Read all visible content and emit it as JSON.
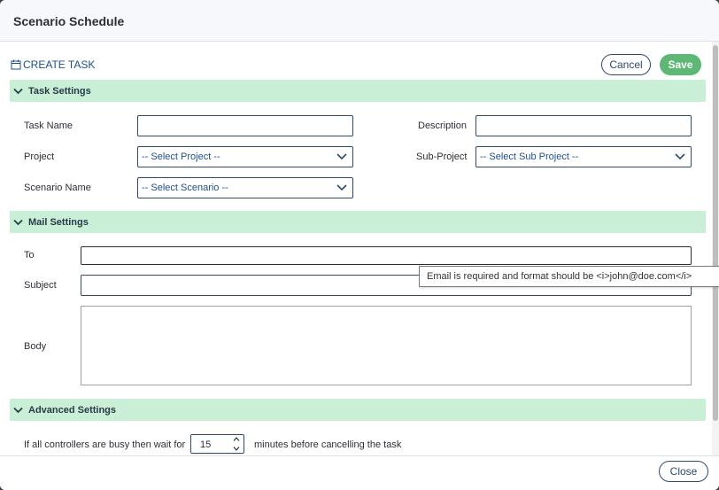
{
  "dialog": {
    "title": "Scenario Schedule"
  },
  "toolbar": {
    "create_task": "CREATE TASK",
    "cancel_label": "Cancel",
    "save_label": "Save"
  },
  "task_settings": {
    "header": "Task Settings",
    "task_name_label": "Task Name",
    "task_name_value": "",
    "description_label": "Description",
    "description_value": "",
    "project_label": "Project",
    "project_selected": "-- Select Project --",
    "sub_project_label": "Sub-Project",
    "sub_project_selected": "-- Select Sub Project --",
    "scenario_label": "Scenario Name",
    "scenario_selected": "-- Select Scenario --"
  },
  "mail_settings": {
    "header": "Mail Settings",
    "to_label": "To",
    "subject_label": "Subject",
    "body_label": "Body",
    "email_tooltip": "Email is required and format should be <i>john@doe.com</i>"
  },
  "advanced_settings": {
    "header": "Advanced Settings",
    "wait_prefix": "If all controllers are busy then wait for",
    "wait_minutes": "15",
    "wait_suffix": "minutes before cancelling the task"
  },
  "footer": {
    "close_label": "Close"
  },
  "icons": {
    "calendar": "calendar-icon",
    "chevron": "chevron-down-icon"
  },
  "colors": {
    "accent": "#1f4e8c",
    "save": "#5cb874",
    "section_bg": "#c9efd7"
  }
}
